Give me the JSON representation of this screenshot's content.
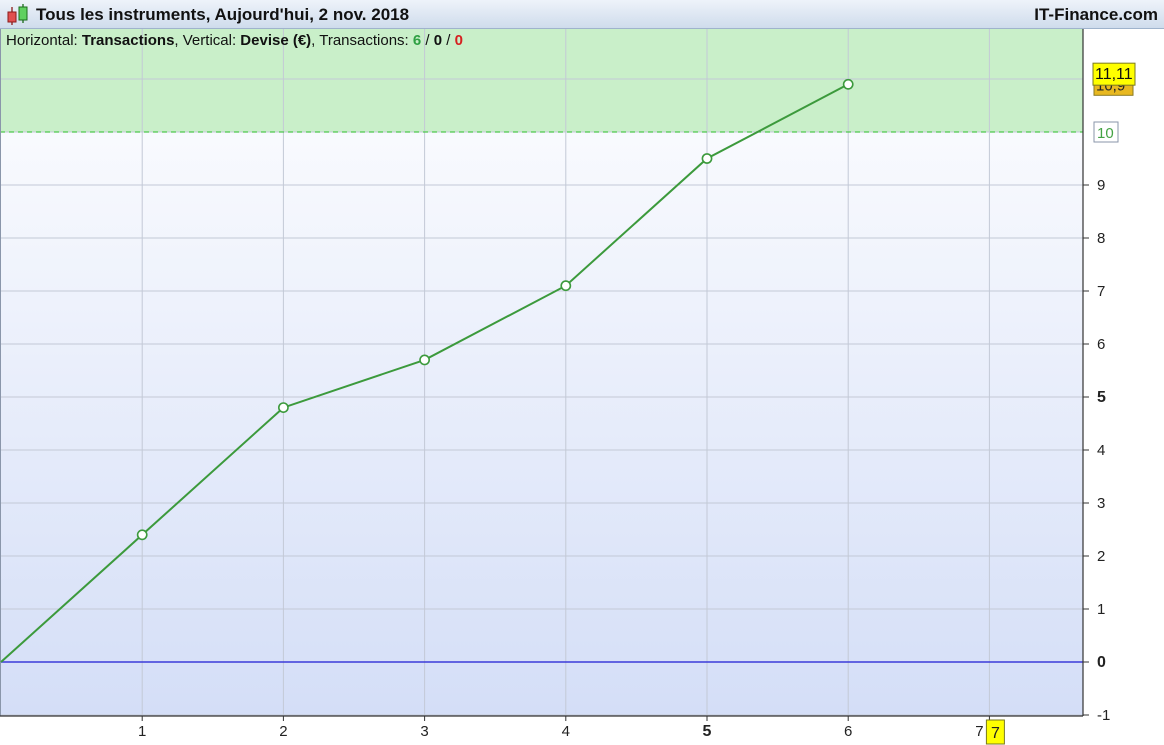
{
  "header": {
    "title": "Tous les instruments, Aujourd'hui, 2 nov. 2018",
    "brand": "IT-Finance.com",
    "icon": "candlestick-icon"
  },
  "info": {
    "horizontal_label": "Horizontal:",
    "horizontal_value": "Transactions",
    "vertical_label": ", Vertical:",
    "vertical_value": "Devise (€)",
    "transactions_label": ", Transactions:",
    "count_positive": "6",
    "sep1": " / ",
    "count_neutral": "0",
    "sep2": " / ",
    "count_negative": "0"
  },
  "chart_data": {
    "type": "line",
    "x": [
      0,
      1,
      2,
      3,
      4,
      5,
      6
    ],
    "y": [
      0,
      2.4,
      4.8,
      5.7,
      7.1,
      9.5,
      10.9
    ],
    "xlim": [
      0,
      7.7
    ],
    "ylim": [
      -1,
      12.3
    ],
    "x_ticks": [
      {
        "value": 1,
        "label": "1"
      },
      {
        "value": 2,
        "label": "2"
      },
      {
        "value": 3,
        "label": "3"
      },
      {
        "value": 4,
        "label": "4"
      },
      {
        "value": 5,
        "label": "5"
      },
      {
        "value": 6,
        "label": "6"
      },
      {
        "value": 7,
        "label": "7"
      }
    ],
    "y_ticks": [
      {
        "value": -1,
        "label": "-1"
      },
      {
        "value": 0,
        "label": "0"
      },
      {
        "value": 1,
        "label": "1"
      },
      {
        "value": 2,
        "label": "2"
      },
      {
        "value": 3,
        "label": "3"
      },
      {
        "value": 4,
        "label": "4"
      },
      {
        "value": 5,
        "label": "5"
      },
      {
        "value": 6,
        "label": "6"
      },
      {
        "value": 7,
        "label": "7"
      },
      {
        "value": 8,
        "label": "8"
      },
      {
        "value": 9,
        "label": "9"
      }
    ],
    "bold_y_ticks": [
      0,
      5
    ],
    "bold_x_ticks": [
      5
    ],
    "grid": true,
    "target_level": {
      "value": 10,
      "label": "10"
    },
    "zero_line": 0,
    "markers": {
      "last_value": {
        "value": 11.11,
        "label": "11,11"
      },
      "hidden_value": {
        "value": 10.9,
        "label": "10,9"
      },
      "x_current": {
        "value": 7,
        "label": "7"
      }
    },
    "colors": {
      "line": "#3c9a3c",
      "marker_fill": "#ffffff",
      "grid": "#c3c9d6",
      "zone_fill": "#c9efc9",
      "zone_dash": "#4fc64f",
      "zero_line": "#3b3bd9",
      "bg_top": "#ffffff",
      "bg_bottom": "#d4def7",
      "highlight": "#ffff00",
      "highlight_orange": "#e8b820",
      "target_label": "#44a344"
    }
  }
}
